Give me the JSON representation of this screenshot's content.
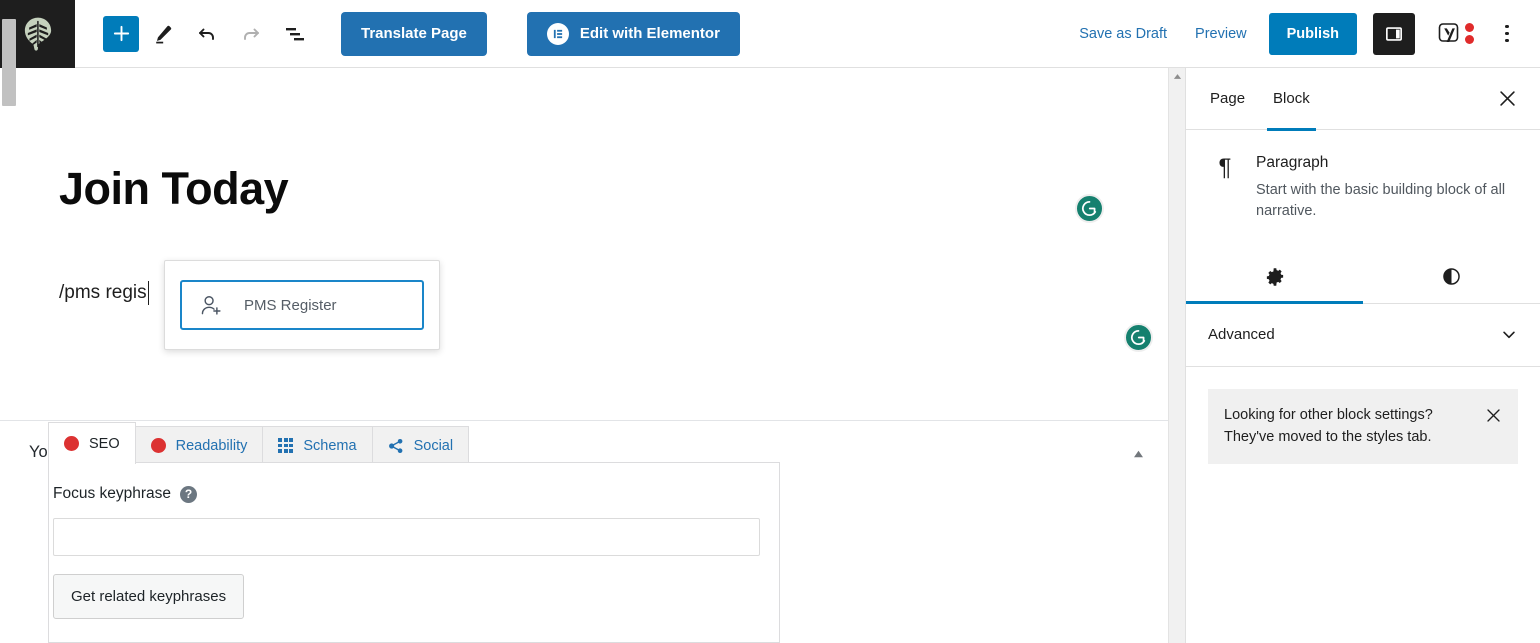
{
  "toolbar": {
    "logo_icon": "monstera-leaf-logo",
    "logo_color": "#c5d1bd",
    "logo_bg": "#1e1e1e",
    "add_block_label": "+",
    "add_block_icon": "plus-icon",
    "tools_icon": "pencil-icon",
    "undo_icon": "undo-arrow-icon",
    "redo_icon": "redo-arrow-icon",
    "list_view_icon": "document-overview-icon",
    "translate_label": "Translate Page",
    "elementor_label": "Edit with Elementor",
    "elementor_icon_letter": "E",
    "save_draft_label": "Save as Draft",
    "preview_label": "Preview",
    "publish_label": "Publish",
    "settings_toggle_icon": "sidebar-panel-icon",
    "yoast_icon": "yoast-logo-icon",
    "more_menu_icon": "three-dots-vertical-icon",
    "accent_blue": "#007cba",
    "button_blue": "#2271b1",
    "yoast_red": "#e02b2b"
  },
  "editor": {
    "post_title": "Join Today",
    "paragraph_text": "/pms regis",
    "autocomplete": {
      "item_label": "PMS Register",
      "item_icon": "user-add-icon",
      "highlight_color": "#1a86c9"
    },
    "grammarly_icon": "grammarly-badge-icon",
    "grammarly_color": "#15806e",
    "scrollbar_up_icon": "scroll-up-arrow-icon"
  },
  "yoast": {
    "panel_title": "Yoast SEO",
    "collapse_icon": "collapse-triangle-icon",
    "tabs": [
      {
        "label": "SEO",
        "icon": "red-circle-icon",
        "active": true
      },
      {
        "label": "Readability",
        "icon": "red-circle-icon",
        "active": false
      },
      {
        "label": "Schema",
        "icon": "grid-icon",
        "active": false
      },
      {
        "label": "Social",
        "icon": "share-icon",
        "active": false
      }
    ],
    "focus_keyphrase_label": "Focus keyphrase",
    "help_icon": "question-mark-icon",
    "help_glyph": "?",
    "focus_keyphrase_value": "",
    "focus_keyphrase_placeholder": "",
    "related_keyphrases_label": "Get related keyphrases"
  },
  "sidebar": {
    "tabs": [
      {
        "label": "Page",
        "active": false
      },
      {
        "label": "Block",
        "active": true
      }
    ],
    "close_icon": "close-x-icon",
    "block": {
      "icon": "paragraph-pilcrow-icon",
      "glyph": "¶",
      "name": "Paragraph",
      "description": "Start with the basic building block of all narrative."
    },
    "mode_tabs": [
      {
        "icon": "gear-icon",
        "name": "settings",
        "active": true
      },
      {
        "icon": "contrast-styles-icon",
        "name": "styles",
        "active": false
      }
    ],
    "advanced_label": "Advanced",
    "advanced_chevron_icon": "chevron-down-icon",
    "notice": {
      "text": "Looking for other block settings? They've moved to the styles tab.",
      "close_icon": "close-x-icon",
      "bg": "#f0f0f0"
    }
  }
}
